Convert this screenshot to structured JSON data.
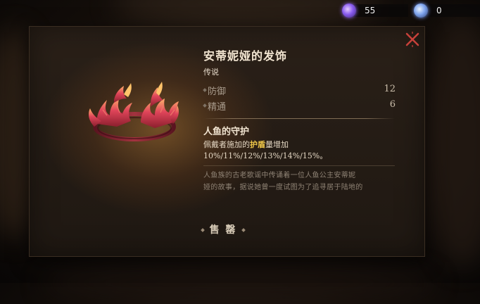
{
  "currencies": [
    {
      "icon": "purple-crystal-icon",
      "value": "55"
    },
    {
      "icon": "blue-orb-icon",
      "value": "0"
    }
  ],
  "item": {
    "name": "安蒂妮娅的发饰",
    "rarity": "传说",
    "stats": [
      {
        "name": "防御",
        "value": "12"
      },
      {
        "name": "精通",
        "value": "6"
      }
    ],
    "skill": {
      "name": "人鱼的守护",
      "desc_before": "佩戴者施加的",
      "desc_highlight": "护盾",
      "desc_after": "量增加",
      "desc_values": "10%/11%/12%/13%/14%/15%。"
    },
    "lore_line1": "人鱼族的古老歌谣中传诵着一位人鱼公主安蒂妮",
    "lore_line2": "娅的故事，据说她曾一度试图为了追寻居于陆地的"
  },
  "actions": {
    "sell_label": "售 罄"
  },
  "colors": {
    "highlight": "#f0c84a",
    "close": "#c8413a",
    "rarity_accent": "#ff9a3c"
  }
}
